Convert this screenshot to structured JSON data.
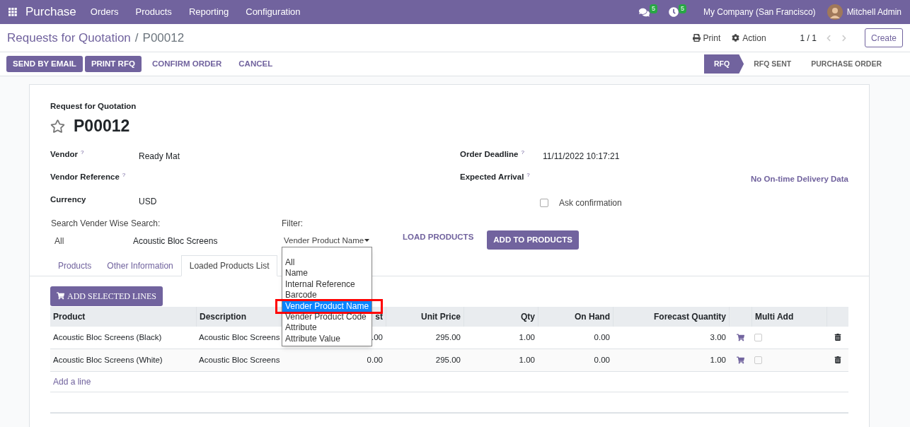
{
  "navbar": {
    "app": "Purchase",
    "menu": [
      "Orders",
      "Products",
      "Reporting",
      "Configuration"
    ],
    "messages_badge": "5",
    "activities_badge": "5",
    "company": "My Company (San Francisco)",
    "user": "Mitchell Admin"
  },
  "breadcrumb": {
    "parent": "Requests for Quotation",
    "separator": "/",
    "current": "P00012"
  },
  "control_panel": {
    "print": "Print",
    "action": "Action",
    "pager": "1 / 1",
    "create": "Create"
  },
  "action_buttons": [
    {
      "label": "SEND BY EMAIL",
      "kind": "primary"
    },
    {
      "label": "PRINT RFQ",
      "kind": "primary"
    },
    {
      "label": "CONFIRM ORDER",
      "kind": "link"
    },
    {
      "label": "CANCEL",
      "kind": "link"
    }
  ],
  "status_bar": [
    {
      "label": "RFQ",
      "selected": true
    },
    {
      "label": "RFQ SENT",
      "selected": false
    },
    {
      "label": "PURCHASE ORDER",
      "selected": false
    }
  ],
  "form": {
    "subtitle": "Request for Quotation",
    "name": "P00012",
    "starred": false,
    "left_fields": [
      {
        "label": "Vendor",
        "help": "?",
        "value": "Ready Mat"
      },
      {
        "label": "Vendor Reference",
        "help": "?"
      },
      {
        "label": "Currency",
        "value": "USD"
      }
    ],
    "right_fields": [
      {
        "label": "Order Deadline",
        "help": "?",
        "value": "11/11/2022 10:17:21"
      },
      {
        "label": "Expected Arrival",
        "help": "?",
        "note": "No On-time Delivery Data"
      }
    ],
    "ask_confirmation": {
      "label": "Ask confirmation",
      "checked": false
    },
    "search": {
      "vendor_label": "Search Vender Wise",
      "vendor_value": "All",
      "search_label": "Search:",
      "search_value": "Acoustic Bloc Screens",
      "filter_label": "Filter:",
      "filter_value": "Vender Product Name",
      "load_button": "LOAD PRODUCTS",
      "add_button": "ADD TO PRODUCTS"
    },
    "filter_options": [
      {
        "label": "All",
        "selected": false
      },
      {
        "label": "Name",
        "selected": false
      },
      {
        "label": "Internal Reference",
        "selected": false
      },
      {
        "label": "Barcode",
        "selected": false
      },
      {
        "label": "Vender Product Name",
        "selected": true
      },
      {
        "label": "Vender Product Code",
        "selected": false
      },
      {
        "label": "Attribute",
        "selected": false
      },
      {
        "label": "Attribute Value",
        "selected": false
      }
    ]
  },
  "tabs": [
    {
      "label": "Products",
      "selected": false
    },
    {
      "label": "Other Information",
      "selected": false
    },
    {
      "label": "Loaded Products List",
      "selected": true
    }
  ],
  "add_selected_button": "ADD SELECTED LINES",
  "table": {
    "columns": [
      "Product",
      "Description",
      "st",
      "Unit Price",
      "Qty",
      "On Hand",
      "Forecast Quantity",
      "Multi Add"
    ],
    "rows": [
      {
        "product": "Acoustic Bloc Screens (Black)",
        "description": "Acoustic Bloc Screens",
        "cost": ".00",
        "unit_price": "295.00",
        "qty": "1.00",
        "on_hand": "0.00",
        "forecast": "3.00",
        "multi_add": false
      },
      {
        "product": "Acoustic Bloc Screens (White)",
        "description": "Acoustic Bloc Screens",
        "cost": "0.00",
        "unit_price": "295.00",
        "qty": "1.00",
        "on_hand": "0.00",
        "forecast": "1.00",
        "multi_add": false
      }
    ],
    "add_line": "Add a line"
  }
}
